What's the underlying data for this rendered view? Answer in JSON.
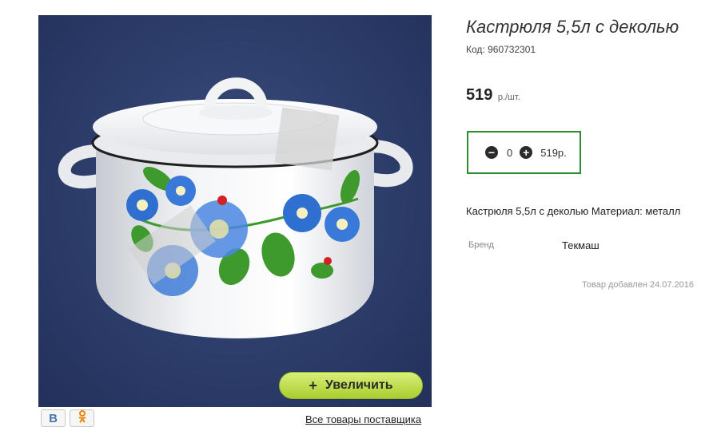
{
  "product": {
    "title": "Кастрюля 5,5л с деколью",
    "code_label": "Код:",
    "code": "960732301",
    "price": "519",
    "price_unit": "р./шт.",
    "description": "Кастрюля 5,5л с деколью Материал: металл",
    "brand_label": "Бренд",
    "brand": "Текмаш",
    "added": "Товар добавлен 24.07.2016"
  },
  "cart": {
    "minus_icon": "minus-circle-icon",
    "quantity": "0",
    "plus_icon": "plus-circle-icon",
    "sum": "519р."
  },
  "gallery": {
    "zoom_plus": "+",
    "zoom_label": "Увеличить",
    "background_color": "#2d3d6a"
  },
  "social": {
    "vk": "В",
    "ok": "ОК"
  },
  "links": {
    "all_goods": "Все товары поставщика"
  },
  "colors": {
    "accent_green": "#2e8b2e",
    "button_green": "#b5d83a"
  }
}
